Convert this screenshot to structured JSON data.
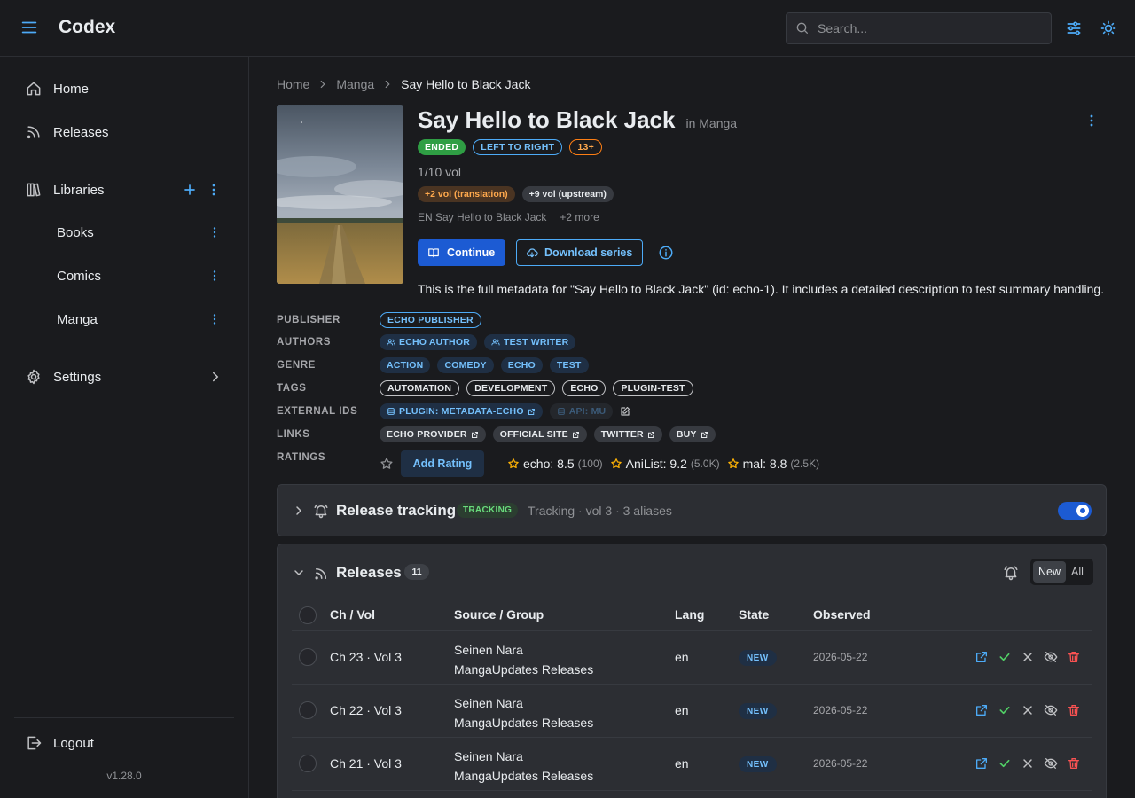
{
  "app": {
    "name": "Codex",
    "version": "v1.28.0"
  },
  "search": {
    "placeholder": "Search..."
  },
  "sidebar": {
    "home": "Home",
    "releases": "Releases",
    "libraries": "Libraries",
    "library_items": [
      "Books",
      "Comics",
      "Manga"
    ],
    "settings": "Settings",
    "logout": "Logout"
  },
  "breadcrumb": [
    "Home",
    "Manga",
    "Say Hello to Black Jack"
  ],
  "series": {
    "title": "Say Hello to Black Jack",
    "in_library": "in Manga",
    "badges": [
      "ENDED",
      "LEFT TO RIGHT",
      "13+"
    ],
    "volume_count": "1/10 vol",
    "vol_badges": [
      "+2 vol (translation)",
      "+9 vol (upstream)"
    ],
    "alt_title": "EN Say Hello to Black Jack",
    "alt_more": "+2 more",
    "continue_label": "Continue",
    "download_label": "Download series",
    "summary": "This is the full metadata for \"Say Hello to Black Jack\" (id: echo-1). It includes a detailed description to test summary handling."
  },
  "metadata": {
    "labels": {
      "publisher": "PUBLISHER",
      "authors": "AUTHORS",
      "genre": "GENRE",
      "tags": "TAGS",
      "external_ids": "EXTERNAL IDS",
      "links": "LINKS",
      "ratings": "RATINGS"
    },
    "publisher": "ECHO PUBLISHER",
    "authors": [
      "ECHO AUTHOR",
      "TEST WRITER"
    ],
    "genres": [
      "ACTION",
      "COMEDY",
      "ECHO",
      "TEST"
    ],
    "tags": [
      "AUTOMATION",
      "DEVELOPMENT",
      "ECHO",
      "PLUGIN-TEST"
    ],
    "external_ids": [
      "PLUGIN: METADATA-ECHO",
      "API: MU"
    ],
    "links": [
      "ECHO PROVIDER",
      "OFFICIAL SITE",
      "TWITTER",
      "BUY"
    ],
    "add_rating_label": "Add Rating",
    "ratings": [
      {
        "label": "echo: 8.5",
        "count": "(100)"
      },
      {
        "label": "AniList: 9.2",
        "count": "(5.0K)"
      },
      {
        "label": "mal: 8.8",
        "count": "(2.5K)"
      }
    ]
  },
  "tracking": {
    "title": "Release tracking",
    "badge": "TRACKING",
    "info": "Tracking · vol 3 · 3 aliases",
    "enabled": true
  },
  "releases": {
    "title": "Releases",
    "count": "11",
    "filter": [
      "New",
      "All"
    ],
    "filter_selected": "New",
    "columns": [
      "Ch / Vol",
      "Source / Group",
      "Lang",
      "State",
      "Observed"
    ],
    "rows": [
      {
        "chvol": "Ch 23 · Vol 3",
        "source": "Seinen Nara",
        "group": "MangaUpdates Releases",
        "lang": "en",
        "state": "NEW",
        "observed": "2026-05-22"
      },
      {
        "chvol": "Ch 22 · Vol 3",
        "source": "Seinen Nara",
        "group": "MangaUpdates Releases",
        "lang": "en",
        "state": "NEW",
        "observed": "2026-05-22"
      },
      {
        "chvol": "Ch 21 · Vol 3",
        "source": "Seinen Nara",
        "group": "MangaUpdates Releases",
        "lang": "en",
        "state": "NEW",
        "observed": "2026-05-22"
      }
    ]
  },
  "colors": {
    "background": "#1a1b1e",
    "accent": "#4dabf7",
    "primary_button": "#1c5bd3",
    "ended_badge": "#2f9e44",
    "rating_star": "#fab005"
  }
}
